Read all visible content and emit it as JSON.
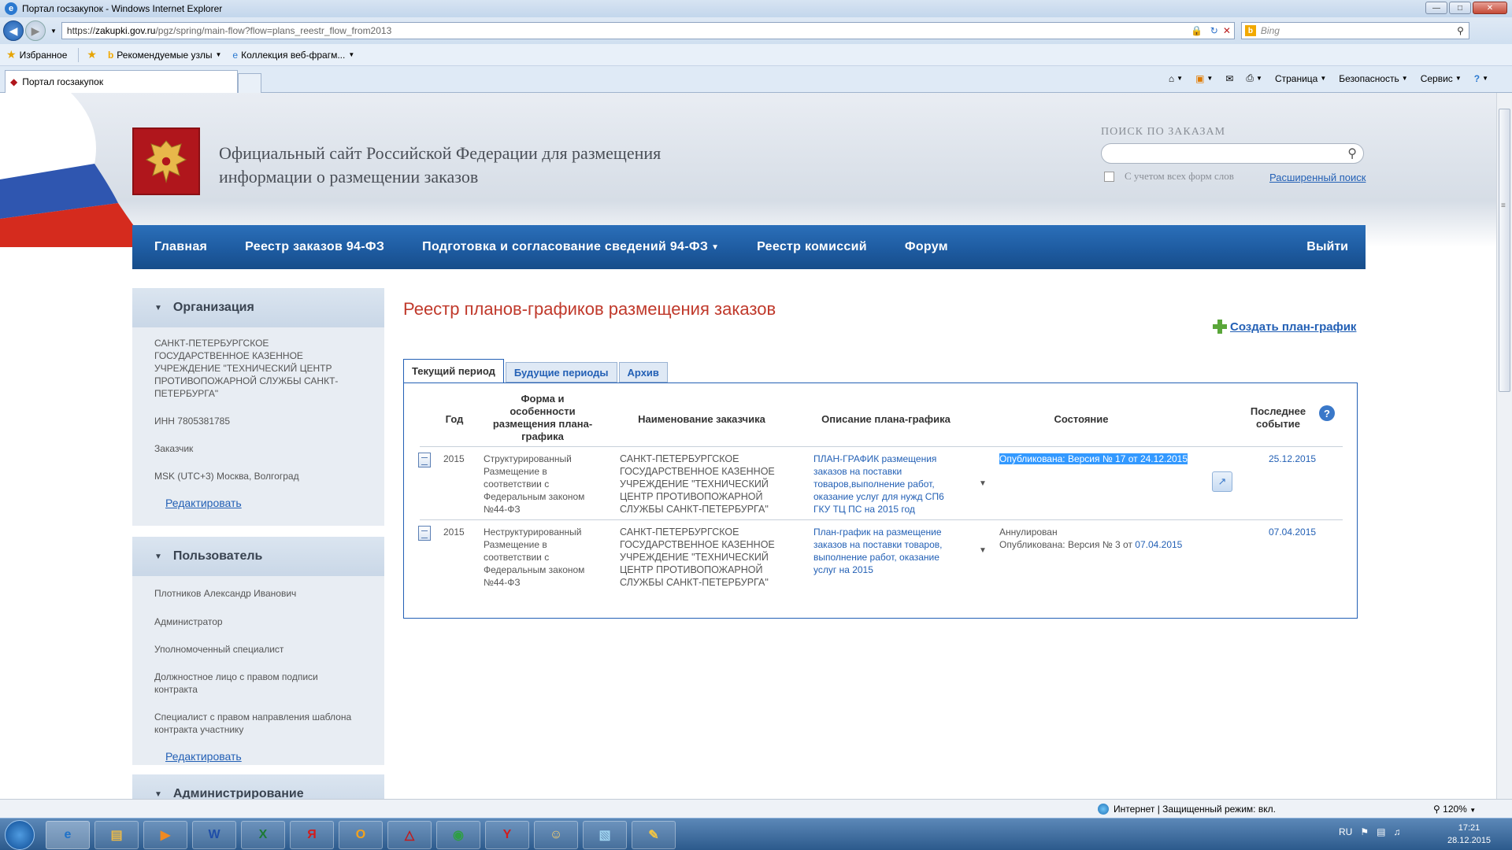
{
  "browser": {
    "window_title": "Портал госзакупок - Windows Internet Explorer",
    "address_scheme": "https://",
    "address_host": "zakupki.gov.ru",
    "address_path": "/pgz/spring/main-flow?flow=plans_reestr_flow_from2013",
    "bing_placeholder": "Bing",
    "favorites": {
      "favorites_label": "Избранное",
      "item1": "Рекомендуемые узлы",
      "item2": "Коллекция веб-фрагм..."
    },
    "tab_title": "Портал госзакупок",
    "commands": {
      "page": "Страница",
      "safety": "Безопасность",
      "service": "Сервис"
    }
  },
  "site": {
    "title_line1": "Официальный сайт Российской Федерации для размещения",
    "title_line2": "информации о размещении заказов",
    "search_label": "ПОИСК ПО ЗАКАЗАМ",
    "search_checkbox_label": "С учетом всех форм слов",
    "advanced_search": "Расширенный поиск",
    "nav": {
      "home": "Главная",
      "registry94": "Реестр заказов 94-ФЗ",
      "preparation": "Подготовка и согласование сведений 94-ФЗ",
      "commissions": "Реестр комиссий",
      "forum": "Форум",
      "logout": "Выйти"
    }
  },
  "sidebar": {
    "org": {
      "header": "Организация",
      "name_line1": "САНКТ-ПЕТЕРБУРГСКОЕ",
      "name_line2": "ГОСУДАРСТВЕННОЕ КАЗЕННОЕ",
      "name_line3": "УЧРЕЖДЕНИЕ \"ТЕХНИЧЕСКИЙ ЦЕНТР",
      "name_line4": "ПРОТИВОПОЖАРНОЙ СЛУЖБЫ САНКТ-",
      "name_line5": "ПЕТЕРБУРГА\"",
      "inn": "ИНН 7805381785",
      "role": "Заказчик",
      "timezone": "MSK (UTC+3) Москва, Волгоград",
      "edit": "Редактировать"
    },
    "user": {
      "header": "Пользователь",
      "name": "Плотников Александр Иванович",
      "role1": "Администратор",
      "role2": "Уполномоченный специалист",
      "role3": "Должностное лицо с правом подписи контракта",
      "role4_line1": "Специалист с правом направления шаблона",
      "role4_line2": "контракта участнику",
      "edit": "Редактировать"
    },
    "admin": {
      "header": "Администрирование"
    }
  },
  "main": {
    "title": "Реестр планов-графиков размещения заказов",
    "create": "Создать план-график",
    "tabs": {
      "current": "Текущий период",
      "future": "Будущие периоды",
      "archive": "Архив"
    },
    "columns": {
      "year": "Год",
      "form_line1": "Форма и",
      "form_line2": "особенности",
      "form_line3": "размещения плана-",
      "form_line4": "графика",
      "customer": "Наименование заказчика",
      "description": "Описание плана-графика",
      "status": "Состояние",
      "last_event_line1": "Последнее",
      "last_event_line2": "событие",
      "help": "?"
    },
    "rows": [
      {
        "year": "2015",
        "form": [
          "Структурированный",
          "Размещение в",
          "соответствии с",
          "Федеральным законом",
          "№44-ФЗ"
        ],
        "customer": [
          "САНКТ-ПЕТЕРБУРГСКОЕ",
          "ГОСУДАРСТВЕННОЕ КАЗЕННОЕ",
          "УЧРЕЖДЕНИЕ \"ТЕХНИЧЕСКИЙ",
          "ЦЕНТР ПРОТИВОПОЖАРНОЙ",
          "СЛУЖБЫ САНКТ-ПЕТЕРБУРГА\""
        ],
        "description": [
          "ПЛАН-ГРАФИК размещения",
          "заказов на поставки",
          "товаров,выполнение работ,",
          "оказание услуг для нужд СП6",
          "ГКУ ТЦ ПС на 2015 год"
        ],
        "status_line1": "Опубликована: Версия №  17 от 24.12.2015",
        "last_event": "25.12.2015"
      },
      {
        "year": "2015",
        "form": [
          "Неструктурированный",
          "Размещение в",
          "соответствии с",
          "Федеральным законом",
          "№44-ФЗ"
        ],
        "customer": [
          "САНКТ-ПЕТЕРБУРГСКОЕ",
          "ГОСУДАРСТВЕННОЕ КАЗЕННОЕ",
          "УЧРЕЖДЕНИЕ \"ТЕХНИЧЕСКИЙ",
          "ЦЕНТР ПРОТИВОПОЖАРНОЙ",
          "СЛУЖБЫ САНКТ-ПЕТЕРБУРГА\""
        ],
        "description": [
          "План-график на размещение",
          "заказов на поставки товаров,",
          "выполнение работ, оказание",
          "услуг на 2015"
        ],
        "status_line1": "Аннулирован",
        "status_line2_prefix": "Опубликована: Версия №  3 от ",
        "status_line2_date": "07.04.2015",
        "last_event": "07.04.2015"
      }
    ]
  },
  "statusbar": {
    "zone": "Интернет | Защищенный режим: вкл.",
    "zoom": "120%"
  },
  "taskbar": {
    "lang": "RU",
    "time": "17:21",
    "date": "28.12.2015"
  },
  "colors": {
    "nav_blue": "#1d5a9f",
    "link": "#2360b5",
    "title_red": "#c0392b",
    "selection": "#3399ff"
  }
}
